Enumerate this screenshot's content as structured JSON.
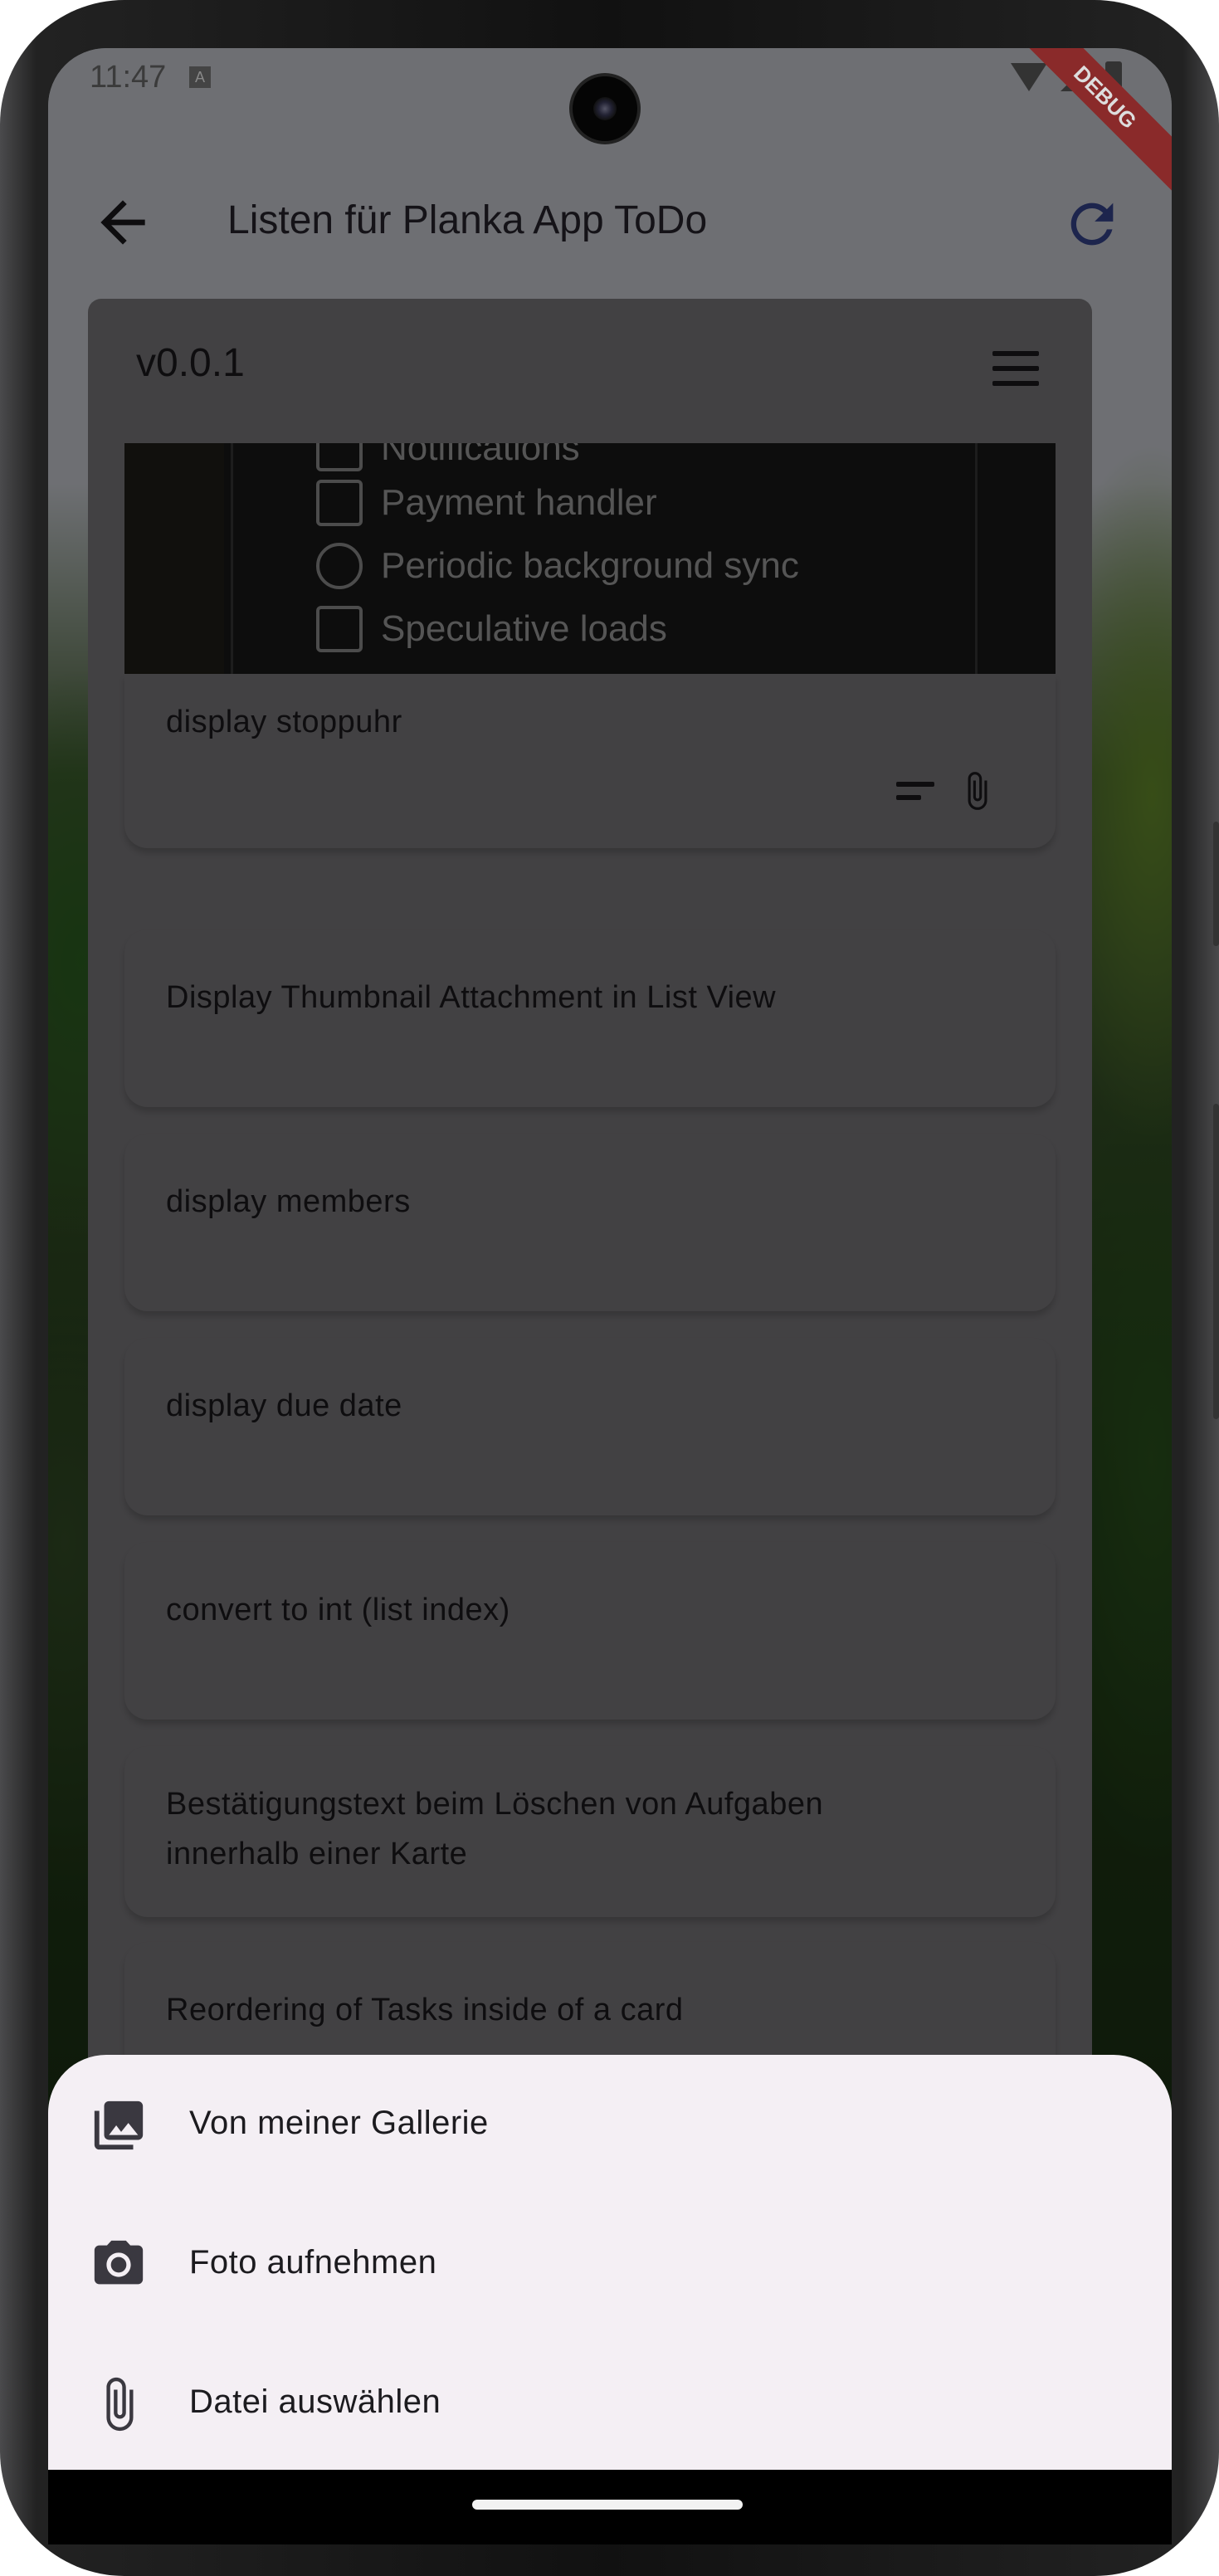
{
  "status_bar": {
    "time": "11:47",
    "notification_icon": "A"
  },
  "debug_banner": "DEBUG",
  "app_bar": {
    "title": "Listen für Planka App ToDo",
    "back_icon": "arrow-back-icon",
    "refresh_icon": "refresh-icon"
  },
  "list": {
    "name": "v0.0.1",
    "attachment_preview": {
      "rows": [
        "Notifications",
        "Payment handler",
        "Periodic background sync",
        "Speculative loads"
      ]
    },
    "cards": [
      {
        "title": "display stoppuhr",
        "has_description": true,
        "has_attachment": true
      },
      {
        "title": "Display Thumbnail Attachment in List View"
      },
      {
        "title": "display members"
      },
      {
        "title": "display due date"
      },
      {
        "title": "convert to int (list index)"
      },
      {
        "title": "Bestätigungstext beim Löschen von Aufgaben innerhalb einer Karte"
      },
      {
        "title": "Reordering of Tasks inside of a card"
      }
    ]
  },
  "bottom_sheet": {
    "items": [
      {
        "label": "Von meiner Gallerie",
        "icon": "photo-library-icon"
      },
      {
        "label": "Foto aufnehmen",
        "icon": "camera-icon"
      },
      {
        "label": "Datei auswählen",
        "icon": "attach-file-icon"
      }
    ]
  },
  "colors": {
    "accent": "#1f3a8a",
    "sheet_bg": "#f4eff4",
    "debug_banner": "#b71c1c"
  }
}
